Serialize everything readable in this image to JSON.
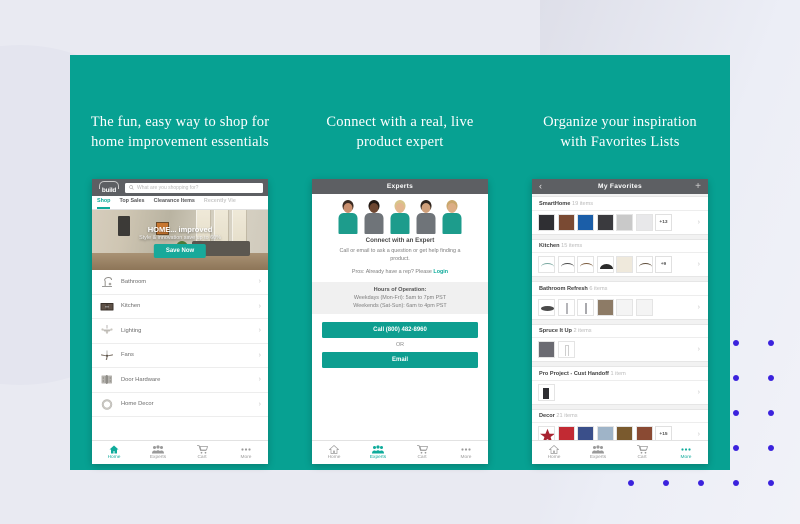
{
  "theme": {
    "panel_teal": "#07a192",
    "accent_teal": "#0fab9b",
    "background": "#e9eaf2",
    "dot_blue": "#3b22dd",
    "dark_bar": "#5d5f63"
  },
  "headlines": [
    "The fun, easy way to shop for\nhome improvement essentials",
    "Connect with a real, live\nproduct expert",
    "Organize your inspiration\nwith Favorites Lists"
  ],
  "shop_screen": {
    "logo_text": "build",
    "search_placeholder": "What are you shopping for?",
    "nav_tabs": [
      {
        "label": "Shop",
        "state": "active"
      },
      {
        "label": "Top Sales",
        "state": "normal"
      },
      {
        "label": "Clearance Items",
        "state": "normal"
      },
      {
        "label": "Recently Vie",
        "state": "faded"
      }
    ],
    "hero": {
      "title": "HOME... improved",
      "subtitle": "Style & innovation save up to 60%",
      "cta_label": "Save Now"
    },
    "categories": [
      {
        "label": "Bathroom",
        "icon": "faucet-icon"
      },
      {
        "label": "Kitchen",
        "icon": "cabinet-icon"
      },
      {
        "label": "Lighting",
        "icon": "chandelier-icon"
      },
      {
        "label": "Fans",
        "icon": "ceiling-fan-icon"
      },
      {
        "label": "Door Hardware",
        "icon": "door-hinge-icon"
      },
      {
        "label": "Home Decor",
        "icon": "wreath-icon"
      }
    ],
    "tabbar": [
      {
        "label": "Home",
        "icon": "home-icon",
        "state": "active"
      },
      {
        "label": "Experts",
        "icon": "experts-icon",
        "state": "normal"
      },
      {
        "label": "Cart",
        "icon": "cart-icon",
        "state": "normal"
      },
      {
        "label": "More",
        "icon": "more-dots-icon",
        "state": "normal"
      }
    ]
  },
  "experts_screen": {
    "header_title": "Experts",
    "people": [
      {
        "skin": "#c98f6e",
        "hair": "#3a2a21",
        "top": "#1d9c8c"
      },
      {
        "skin": "#6d4630",
        "hair": "#221812",
        "top": "#6f7479"
      },
      {
        "skin": "#e3b68f",
        "hair": "#d8c48a",
        "top": "#1d9c8c"
      },
      {
        "skin": "#d0a07a",
        "hair": "#2f241c",
        "top": "#6f7479"
      },
      {
        "skin": "#dcae85",
        "hair": "#c9a76c",
        "top": "#1d9c8c"
      }
    ],
    "connect_title": "Connect with an Expert",
    "connect_desc": "Call or email to ask a question or get help finding a product.",
    "pro_prefix": "Pros: Already have a rep? Please ",
    "pro_link": "Login",
    "hours_title": "Hours of Operation:",
    "hours_lines": [
      "Weekdays (Mon-Fri): 5am to 7pm PST",
      "Weekends (Sat-Sun): 6am to 4pm PST"
    ],
    "call_label": "Call (800) 482-8960",
    "or_label": "OR",
    "email_label": "Email",
    "tabbar": [
      {
        "label": "Home",
        "icon": "home-icon",
        "state": "normal"
      },
      {
        "label": "Experts",
        "icon": "experts-icon",
        "state": "active"
      },
      {
        "label": "Cart",
        "icon": "cart-icon",
        "state": "normal"
      },
      {
        "label": "More",
        "icon": "more-dots-icon",
        "state": "normal"
      }
    ]
  },
  "favorites_screen": {
    "header_title": "My Favorites",
    "back_icon": "chevron-left-icon",
    "add_icon": "plus-icon",
    "lists": [
      {
        "name": "SmartHome",
        "count": "19 items",
        "overflow": "+13",
        "thumbs": [
          "#2f2f33",
          "#7a4a33",
          "#1b5ea8",
          "#3a3a3e",
          "#b9b9b9",
          "#e3e3e3"
        ]
      },
      {
        "name": "Kitchen",
        "count": "15 items",
        "overflow": "+9",
        "thumbs": [
          "#8ab6ae",
          "#4a4a4a",
          "#7b5a3c",
          "#2b2b2b",
          "#d9d2c2",
          "#5c4a38"
        ]
      },
      {
        "name": "Bathroom Refresh",
        "count": "6 items",
        "overflow": "",
        "thumbs": [
          "#4a4a4a",
          "#c0c0c4",
          "#b8b8bc",
          "#8d7b66",
          "#f0f0f0",
          "#f0f0f0"
        ]
      },
      {
        "name": "Spruce It Up",
        "count": "2 items",
        "overflow": "",
        "thumbs": [
          "#6b6b72",
          "#e8e8e8"
        ]
      },
      {
        "name": "Pro Project - Cust Handoff",
        "count": "1 item",
        "overflow": "",
        "thumbs": [
          "#2e2e32"
        ]
      },
      {
        "name": "Decor",
        "count": "21 items",
        "overflow": "+15",
        "thumbs": [
          "#a82330",
          "#c22a33",
          "#3a4f8a",
          "#9fb4c8",
          "#7a5a2e",
          "#8a4a33"
        ]
      }
    ],
    "tabbar": [
      {
        "label": "Home",
        "icon": "home-icon",
        "state": "normal"
      },
      {
        "label": "Experts",
        "icon": "experts-icon",
        "state": "normal"
      },
      {
        "label": "Cart",
        "icon": "cart-icon",
        "state": "normal"
      },
      {
        "label": "More",
        "icon": "more-dots-icon",
        "state": "active"
      }
    ]
  }
}
